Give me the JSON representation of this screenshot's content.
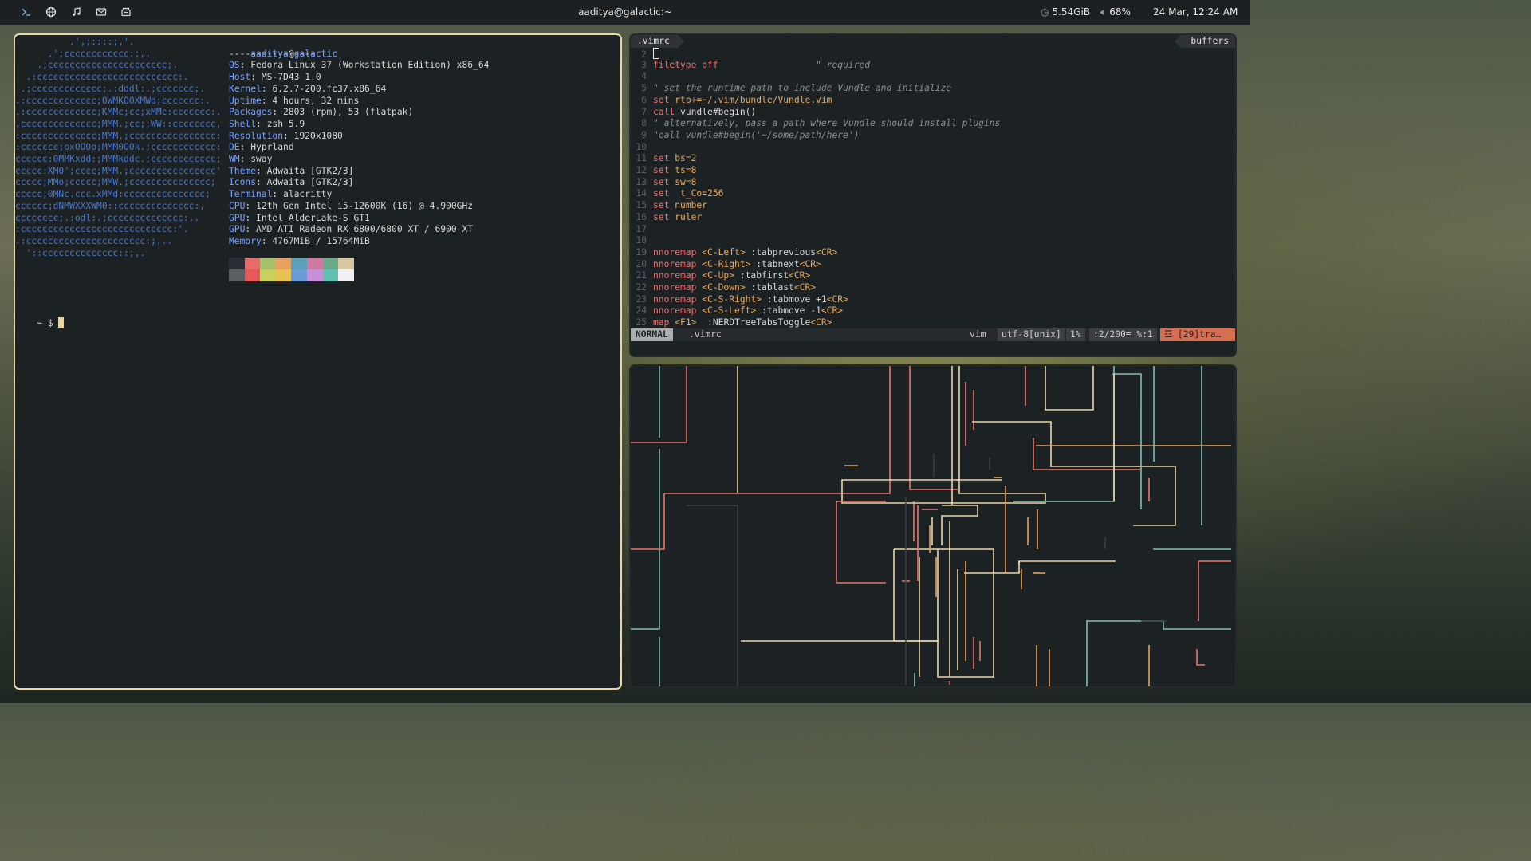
{
  "topbar": {
    "title": "aaditya@galactic:~",
    "icons": [
      "terminal-icon",
      "globe-icon",
      "music-icon",
      "mail-icon",
      "files-icon"
    ],
    "memory": "5.54GiB",
    "volume": "68%",
    "datetime": "24 Mar, 12:24 AM"
  },
  "terminal": {
    "logo_lines": [
      "          .',;::::;,'.",
      "      .';cccccccccccc:;,.",
      "    .;cccccccccccccccccccccc;.",
      "  .:cccccccccccccccccccccccccc:.",
      " .;ccccccccccccc;.:dddl:.;ccccccc;.",
      ".:ccccccccccccc;OWMKOOXMWd;ccccccc:.",
      ".:ccccccccccccc;KMMc;cc;xMMc:ccccccc:.",
      ",cccccccccccccc;MMM.;cc;;WW::cccccccc,",
      ":cccccccccccccc;MMM.;cccccccccccccccc:",
      ":ccccccc;oxOOOo;MMM0OOk.;cccccccccccc:",
      "cccccc:0MMKxdd:;MMMkddc.;cccccccccccc;",
      "ccccc:XM0';cccc;MMM.;cccccccccccccccc'",
      "ccccc;MMo;ccccc;MMW.;ccccccccccccccc;",
      "ccccc;0MNc.ccc.xMMd:ccccccccccccccc;",
      "cccccc;dNMWXXXWM0::cccccccccccccc:,",
      "cccccccc;.:odl:.;cccccccccccccc:,.",
      ":cccccccccccccccccccccccccccc:'.",
      ".:cccccccccccccccccccccc:;,..",
      "  '::cccccccccccccc::;,."
    ],
    "user": "aaditya",
    "at": "@",
    "host": "galactic",
    "separator": "----------------",
    "info": [
      {
        "key": "OS",
        "value": "Fedora Linux 37 (Workstation Edition) x86_64"
      },
      {
        "key": "Host",
        "value": "MS-7D43 1.0"
      },
      {
        "key": "Kernel",
        "value": "6.2.7-200.fc37.x86_64"
      },
      {
        "key": "Uptime",
        "value": "4 hours, 32 mins"
      },
      {
        "key": "Packages",
        "value": "2803 (rpm), 53 (flatpak)"
      },
      {
        "key": "Shell",
        "value": "zsh 5.9"
      },
      {
        "key": "Resolution",
        "value": "1920x1080"
      },
      {
        "key": "DE",
        "value": "Hyprland"
      },
      {
        "key": "WM",
        "value": "sway"
      },
      {
        "key": "Theme",
        "value": "Adwaita [GTK2/3]"
      },
      {
        "key": "Icons",
        "value": "Adwaita [GTK2/3]"
      },
      {
        "key": "Terminal",
        "value": "alacritty"
      },
      {
        "key": "CPU",
        "value": "12th Gen Intel i5-12600K (16) @ 4.900GHz"
      },
      {
        "key": "GPU",
        "value": "Intel AlderLake-S GT1"
      },
      {
        "key": "GPU",
        "value": "AMD ATI Radeon RX 6800/6800 XT / 6900 XT"
      },
      {
        "key": "Memory",
        "value": "4767MiB / 15764MiB"
      }
    ],
    "palette_top": [
      "#2b2f33",
      "#e86a6a",
      "#a9c06a",
      "#e8a060",
      "#5aa0b8",
      "#d07aa0",
      "#6aaa8a",
      "#d8c8a0"
    ],
    "palette_bottom": [
      "#5a5e62",
      "#e85a5a",
      "#c8d060",
      "#e8c050",
      "#6a9ad8",
      "#c890d8",
      "#60c0b0",
      "#f0f0f0"
    ],
    "prompt": "~ $"
  },
  "vim": {
    "tab": ".vimrc",
    "buffers": "buffers",
    "lines": [
      {
        "n": "2",
        "parts": []
      },
      {
        "n": "3",
        "parts": [
          [
            "kw",
            "filetype off"
          ],
          [
            "tx",
            "                  "
          ],
          [
            "cm",
            "\" required"
          ]
        ]
      },
      {
        "n": "4",
        "parts": []
      },
      {
        "n": "5",
        "parts": [
          [
            "cm",
            "\" set the runtime path to include Vundle and initialize"
          ]
        ]
      },
      {
        "n": "6",
        "parts": [
          [
            "kw",
            "set "
          ],
          [
            "mp",
            "rtp+=~/.vim/bundle/Vundle.vim"
          ]
        ]
      },
      {
        "n": "7",
        "parts": [
          [
            "kw",
            "call "
          ],
          [
            "tx",
            "vundle#begin()"
          ]
        ]
      },
      {
        "n": "8",
        "parts": [
          [
            "cm",
            "\" alternatively, pass a path where Vundle should install plugins"
          ]
        ]
      },
      {
        "n": "9",
        "parts": [
          [
            "cm",
            "\"call vundle#begin('~/some/path/here')"
          ]
        ]
      },
      {
        "n": "10",
        "parts": []
      },
      {
        "n": "11",
        "parts": [
          [
            "kw",
            "set "
          ],
          [
            "mp",
            "bs=2"
          ]
        ]
      },
      {
        "n": "12",
        "parts": [
          [
            "kw",
            "set "
          ],
          [
            "mp",
            "ts=8"
          ]
        ]
      },
      {
        "n": "13",
        "parts": [
          [
            "kw",
            "set "
          ],
          [
            "mp",
            "sw=8"
          ]
        ]
      },
      {
        "n": "14",
        "parts": [
          [
            "kw",
            "set "
          ],
          [
            "mp",
            " t_Co=256"
          ]
        ]
      },
      {
        "n": "15",
        "parts": [
          [
            "kw",
            "set "
          ],
          [
            "mp",
            "number"
          ]
        ]
      },
      {
        "n": "16",
        "parts": [
          [
            "kw",
            "set "
          ],
          [
            "mp",
            "ruler"
          ]
        ]
      },
      {
        "n": "17",
        "parts": []
      },
      {
        "n": "18",
        "parts": []
      },
      {
        "n": "19",
        "parts": [
          [
            "kw",
            "nnoremap "
          ],
          [
            "mp",
            "<C-Left>"
          ],
          [
            "tx",
            " :tabprevious"
          ],
          [
            "mp",
            "<CR>"
          ]
        ]
      },
      {
        "n": "20",
        "parts": [
          [
            "kw",
            "nnoremap "
          ],
          [
            "mp",
            "<C-Right>"
          ],
          [
            "tx",
            " :tabnext"
          ],
          [
            "mp",
            "<CR>"
          ]
        ]
      },
      {
        "n": "21",
        "parts": [
          [
            "kw",
            "nnoremap "
          ],
          [
            "mp",
            "<C-Up>"
          ],
          [
            "tx",
            " :tabfirst"
          ],
          [
            "mp",
            "<CR>"
          ]
        ]
      },
      {
        "n": "22",
        "parts": [
          [
            "kw",
            "nnoremap "
          ],
          [
            "mp",
            "<C-Down>"
          ],
          [
            "tx",
            " :tablast"
          ],
          [
            "mp",
            "<CR>"
          ]
        ]
      },
      {
        "n": "23",
        "parts": [
          [
            "kw",
            "nnoremap "
          ],
          [
            "mp",
            "<C-S-Right>"
          ],
          [
            "tx",
            " :tabmove +1"
          ],
          [
            "mp",
            "<CR>"
          ]
        ]
      },
      {
        "n": "24",
        "parts": [
          [
            "kw",
            "nnoremap "
          ],
          [
            "mp",
            "<C-S-Left>"
          ],
          [
            "tx",
            " :tabmove -1"
          ],
          [
            "mp",
            "<CR>"
          ]
        ]
      },
      {
        "n": "25",
        "parts": [
          [
            "kw",
            "map "
          ],
          [
            "mp",
            "<F1>"
          ],
          [
            "tx",
            "  :NERDTreeTabsToggle"
          ],
          [
            "mp",
            "<CR>"
          ]
        ]
      }
    ],
    "status": {
      "mode": "NORMAL",
      "file": ".vimrc",
      "filetype": "vim",
      "encoding": "utf-8[unix]",
      "percent": "1%",
      "position": ":2/200≡ %:1",
      "warning": "☲ [29]tra…"
    }
  }
}
